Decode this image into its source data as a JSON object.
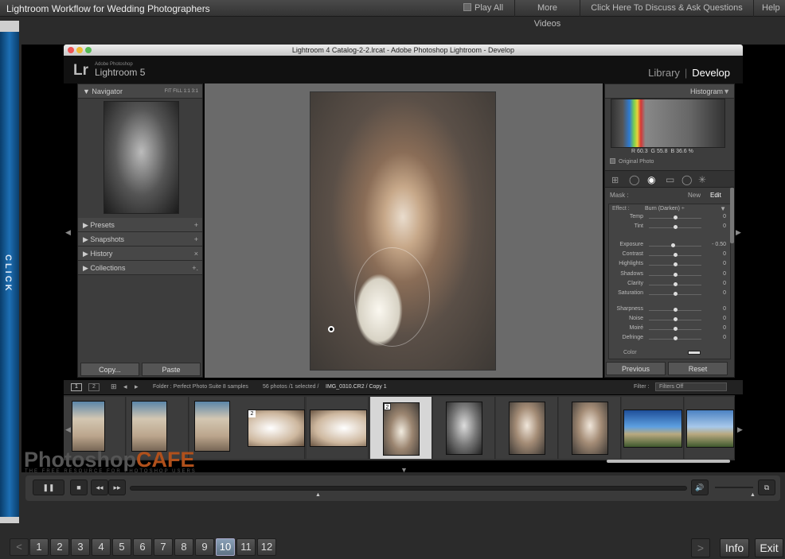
{
  "player": {
    "title": "Lightroom Workflow for Wedding Photographers",
    "play_all": "Play All",
    "more_videos": "More Videos",
    "discuss": "Click Here To Discuss & Ask Questions",
    "help": "Help",
    "side_tab": "CLICK",
    "pages": [
      "1",
      "2",
      "3",
      "4",
      "5",
      "6",
      "7",
      "8",
      "9",
      "10",
      "11",
      "12"
    ],
    "active_page": "10",
    "info": "Info",
    "exit": "Exit",
    "prev": "<",
    "next": ">"
  },
  "window": {
    "title": "Lightroom 4 Catalog-2-2.lrcat - Adobe Photoshop Lightroom - Develop"
  },
  "lightroom": {
    "logo": "Lr",
    "brand_small": "Adobe Photoshop",
    "brand": "Lightroom 5",
    "modules": {
      "library": "Library",
      "separator": "|",
      "develop": "Develop"
    }
  },
  "left_panel": {
    "navigator": "Navigator",
    "nav_zoom": "FIT  FILL  1:1  3:1",
    "sections": [
      {
        "label": "Presets",
        "action": "+"
      },
      {
        "label": "Snapshots",
        "action": "+"
      },
      {
        "label": "History",
        "action": "×"
      },
      {
        "label": "Collections",
        "action": "+."
      }
    ],
    "copy": "Copy...",
    "paste": "Paste"
  },
  "right_panel": {
    "histogram": "Histogram",
    "rgb": {
      "r_label": "R",
      "r": "60.3",
      "g_label": "G",
      "g": "55.8",
      "b_label": "B",
      "b": "36.6",
      "unit": "%"
    },
    "original_photo": "Original Photo",
    "mask": "Mask :",
    "mask_new": "New",
    "mask_edit": "Edit",
    "effect_label": "Effect :",
    "effect_value": "Burn (Darken) ÷",
    "sliders": [
      {
        "label": "Temp",
        "value": "0",
        "pos": 0.5
      },
      {
        "label": "Tint",
        "value": "0",
        "pos": 0.5
      },
      {
        "label": "Exposure",
        "value": "- 0.50",
        "pos": 0.45
      },
      {
        "label": "Contrast",
        "value": "0",
        "pos": 0.5
      },
      {
        "label": "Highlights",
        "value": "0",
        "pos": 0.5
      },
      {
        "label": "Shadows",
        "value": "0",
        "pos": 0.5
      },
      {
        "label": "Clarity",
        "value": "0",
        "pos": 0.5
      },
      {
        "label": "Saturation",
        "value": "0",
        "pos": 0.5
      },
      {
        "label": "Sharpness",
        "value": "0",
        "pos": 0.5
      },
      {
        "label": "Noise",
        "value": "0",
        "pos": 0.5
      },
      {
        "label": "Moiré",
        "value": "0",
        "pos": 0.5
      },
      {
        "label": "Defringe",
        "value": "0",
        "pos": 0.5
      }
    ],
    "color": "Color",
    "previous": "Previous",
    "reset": "Reset"
  },
  "filmbar": {
    "view1": "1",
    "view2": "2",
    "folder": "Folder : Perfect Photo Suite 8 samples",
    "count": "56 photos /1 selected /",
    "file": "IMG_0310.CR2 / Copy 1",
    "filter_label": "Filter :",
    "filter_value": "Filters Off"
  },
  "filmstrip": {
    "badge_a": "2",
    "badge_b": "2"
  },
  "watermark": {
    "photoshop": "Photoshop",
    "cafe": "CAFE",
    "tagline": "THE FREE RESOURCE FOR PHOTOSHOP USERS"
  },
  "playback": {
    "pause": "❚❚",
    "stop": "■",
    "rewind": "◂◂",
    "forward": "▸▸",
    "volume_icon": "🔊"
  }
}
